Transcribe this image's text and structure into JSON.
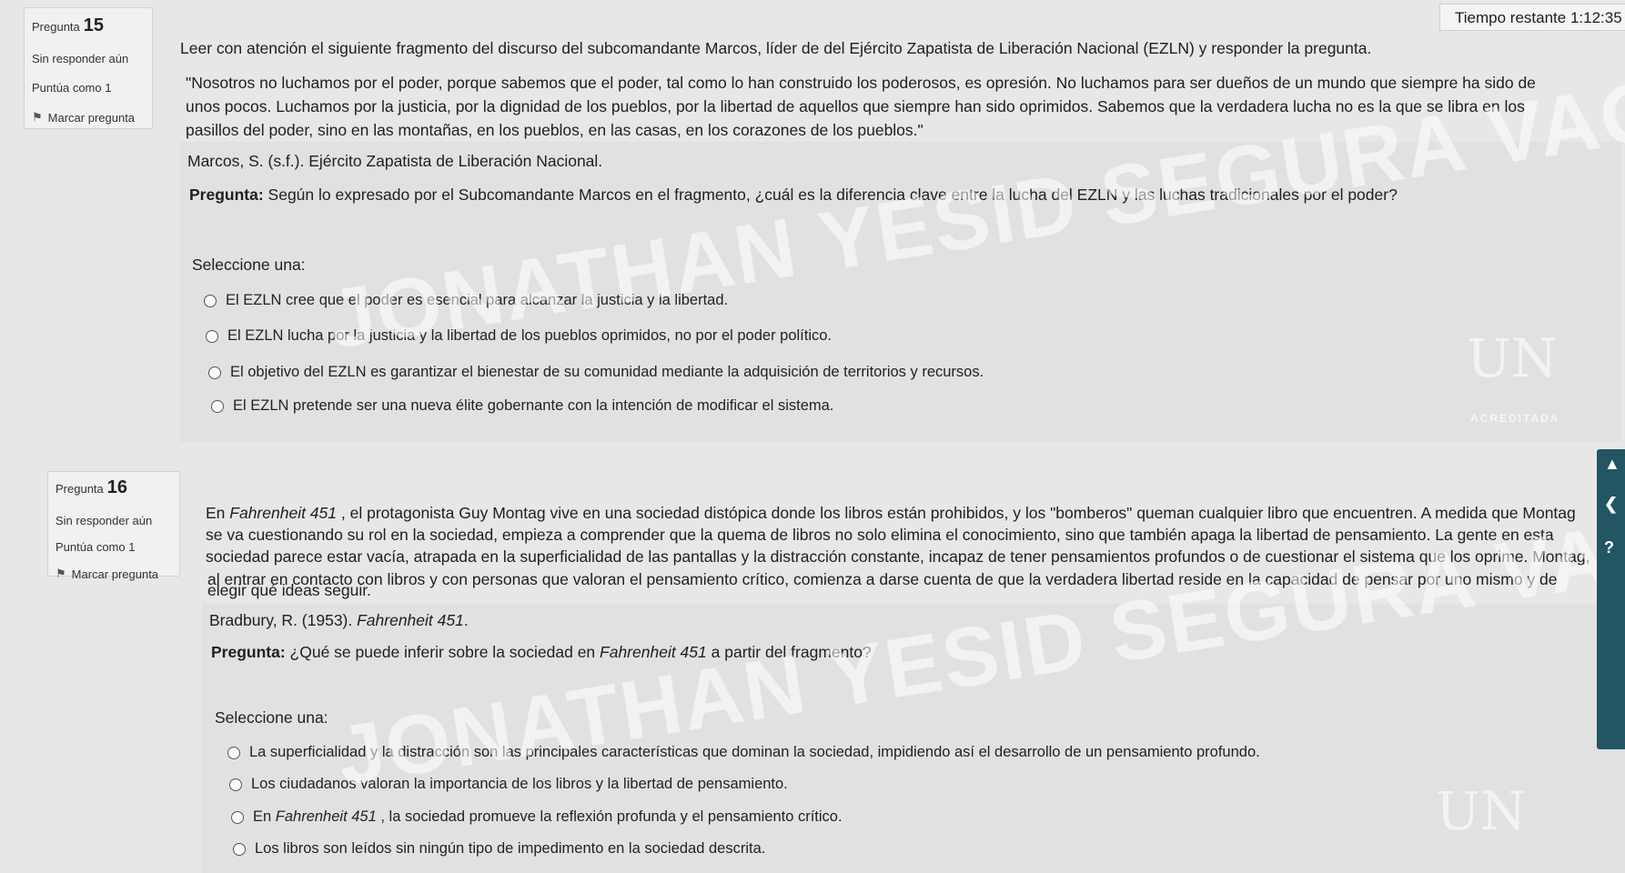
{
  "timer": {
    "label": "Tiempo restante",
    "value": "1:12:35"
  },
  "questions": [
    {
      "label": "Pregunta",
      "number": "15",
      "status": "Sin responder aún",
      "points": "Puntúa como 1",
      "flag_label": "Marcar pregunta",
      "intro": "Leer con atención el siguiente fragmento del discurso del subcomandante Marcos, líder de del Ejército Zapatista de Liberación Nacional (EZLN) y responder la pregunta.",
      "quote_lines": [
        "\"Nosotros no luchamos por el poder, porque sabemos que el poder, tal como lo han construido los poderosos, es opresión. No luchamos para ser dueños de un mundo que siempre ha sido de",
        "unos pocos. Luchamos por la justicia, por la dignidad de los pueblos, por la libertad de aquellos que siempre han sido oprimidos. Sabemos que la verdadera lucha no es la que se libra en los",
        "pasillos del poder, sino en las montañas, en los pueblos, en las casas, en los corazones de los pueblos.\""
      ],
      "citation": "Marcos, S. (s.f.). Ejército Zapatista de Liberación Nacional.",
      "prompt_label": "Pregunta:",
      "prompt_text": " Según lo expresado por el Subcomandante Marcos en el fragmento, ¿cuál es la diferencia clave entre la lucha del EZLN y las luchas tradicionales por el poder?",
      "select_label": "Seleccione una:",
      "options": [
        "El EZLN cree que el poder es esencial para alcanzar la justicia y la libertad.",
        "El EZLN lucha por la justicia y la libertad de los pueblos oprimidos, no por el poder político.",
        "El objetivo del EZLN es garantizar el bienestar de su comunidad mediante la adquisición de territorios y recursos.",
        "El EZLN pretende ser una nueva élite gobernante con la intención de modificar el sistema."
      ]
    },
    {
      "label": "Pregunta",
      "number": "16",
      "status": "Sin responder aún",
      "points": "Puntúa como 1",
      "flag_label": "Marcar pregunta",
      "intro_a": "En ",
      "intro_title": "Fahrenheit 451",
      "intro_b": " , el protagonista Guy Montag vive en una sociedad distópica donde los libros están prohibidos, y los \"bomberos\" queman cualquier libro que encuentren. A medida que Montag",
      "body_lines": [
        "se va cuestionando su rol en la sociedad, empieza a comprender que la quema de libros no solo elimina el conocimiento, sino que también apaga la libertad de pensamiento. La gente en esta",
        "sociedad parece estar vacía, atrapada en la superficialidad de las pantallas y la distracción constante, incapaz de tener pensamientos profundos o de cuestionar el sistema que los oprime. Montag,",
        "al entrar en contacto con libros y con personas que valoran el pensamiento crítico, comienza a darse cuenta de que la verdadera libertad reside en la capacidad de pensar por uno mismo y de",
        "elegir qué ideas seguir."
      ],
      "citation_a": "Bradbury, R. (1953). ",
      "citation_title": "Fahrenheit 451",
      "citation_b": ".",
      "prompt_label": "Pregunta:",
      "prompt_a": " ¿Qué se puede inferir sobre la sociedad en ",
      "prompt_title": "Fahrenheit 451",
      "prompt_b": " a partir del fragmento?",
      "select_label": "Seleccione una:",
      "options": [
        "La superficialidad y la distracción son las principales características que dominan la sociedad, impidiendo así el desarrollo de un pensamiento profundo.",
        "Los ciudadanos valoran la importancia de los libros y la libertad de pensamiento.",
        "Los libros son leídos sin ningún tipo de impedimento en la sociedad descrita."
      ],
      "option3_a": "En ",
      "option3_title": "Fahrenheit 451",
      "option3_b": " , la sociedad promueve la reflexión profunda y el pensamiento crítico."
    }
  ],
  "watermark": {
    "line1": "JONATHAN YESID SEGURA VAQUIRO",
    "logo": "UN",
    "badge": "ACREDITADA"
  },
  "icons": {
    "flag": "flag-icon",
    "radio": "radio-icon",
    "side": [
      "up-arrow-icon",
      "back-arrow-icon",
      "help-icon"
    ]
  }
}
